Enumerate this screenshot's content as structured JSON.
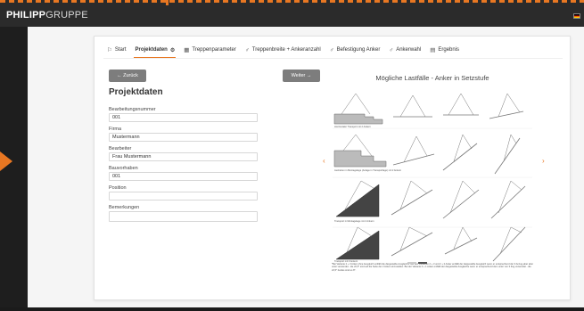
{
  "header": {
    "logo_bold": "PHILIPP",
    "logo_light": "GRUPPE"
  },
  "tabs": [
    {
      "icon": "⚐",
      "label": "Start",
      "after": ""
    },
    {
      "icon": "",
      "label": "Projektdaten",
      "after": "⚙"
    },
    {
      "icon": "▦",
      "label": "Treppenparameter",
      "after": ""
    },
    {
      "icon": "♂",
      "label": "Treppenbreite + Ankeranzahl",
      "after": ""
    },
    {
      "icon": "♂",
      "label": "Befestigung Anker",
      "after": ""
    },
    {
      "icon": "♂",
      "label": "Ankerwahl",
      "after": ""
    },
    {
      "icon": "▤",
      "label": "Ergebnis",
      "after": ""
    }
  ],
  "buttons": {
    "back": "← Zurück",
    "next": "Weiter →"
  },
  "form": {
    "title": "Projektdaten",
    "fields": [
      {
        "label": "Bearbeitungsnummer",
        "value": "001"
      },
      {
        "label": "Firma",
        "value": "Mustermann"
      },
      {
        "label": "Bearbeiter",
        "value": "Frau Mustermann"
      },
      {
        "label": "Bauvorhaben",
        "value": "001"
      },
      {
        "label": "Position",
        "value": ""
      },
      {
        "label": "Bemerkungen",
        "value": ""
      }
    ]
  },
  "figure": {
    "title": "Mögliche Lastfälle - Anker in Setzstufe",
    "captions": [
      "Horizontaler Transport mit 2 Ankern",
      "Ausheben in Montagelage (Anlage in Transportlage) mit 2 Ankern",
      "Transport in Montagelage mit 2 Ankern",
      "Transport mit 3 Ankern"
    ],
    "notes": "*Bei Variante 2 + 3 Anker ohne Ausgleich entfällt die dargestellte Ausgleichs. Bei den Varianten 2 + 3 und 2 + 2 Anker entfällt der dargestellte Ausgleich wenn er entsprechend der 3 Anzug-aber aber unter verwendet - die 22,5° sind auf die Seite der 2 Anker einzustellen. Bei der Variante 2 + 1 Anker entfällt der dargestellte Ausgleiche wenn er entsprechend dem unter von 3 Zug verwendet - die 22,5° beides sind es 8°."
  },
  "slider": {
    "prev": "‹",
    "next": "›",
    "slides": 2,
    "active": 2
  },
  "colors": {
    "accent": "#e87722",
    "button": "#7d7d7d"
  }
}
